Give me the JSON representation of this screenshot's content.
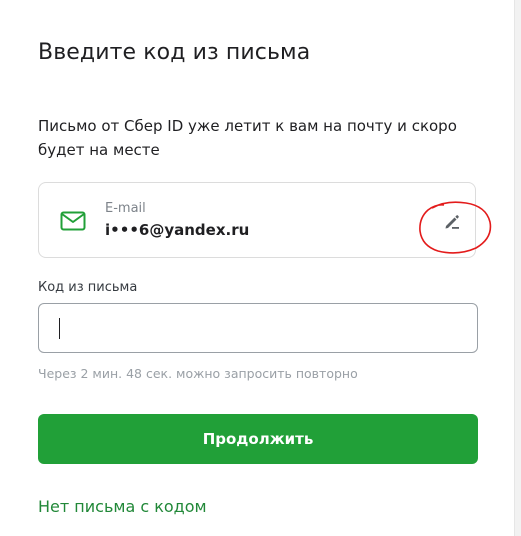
{
  "title": "Введите код из письма",
  "description": "Письмо от Сбер ID уже летит к вам на почту и скоро будет на месте",
  "email_card": {
    "label": "E-mail",
    "value": "i•••6@yandex.ru",
    "icon": "mail-icon",
    "edit_icon": "pencil-icon"
  },
  "code_field": {
    "label": "Код из письма",
    "value": "",
    "placeholder": ""
  },
  "resend_hint": "Через 2 мин. 48 сек. можно запросить повторно",
  "continue_label": "Продолжить",
  "no_email_link": "Нет письма с кодом",
  "colors": {
    "brand_green": "#21a038",
    "link_green": "#218838",
    "annotation_red": "#e31b1b"
  }
}
